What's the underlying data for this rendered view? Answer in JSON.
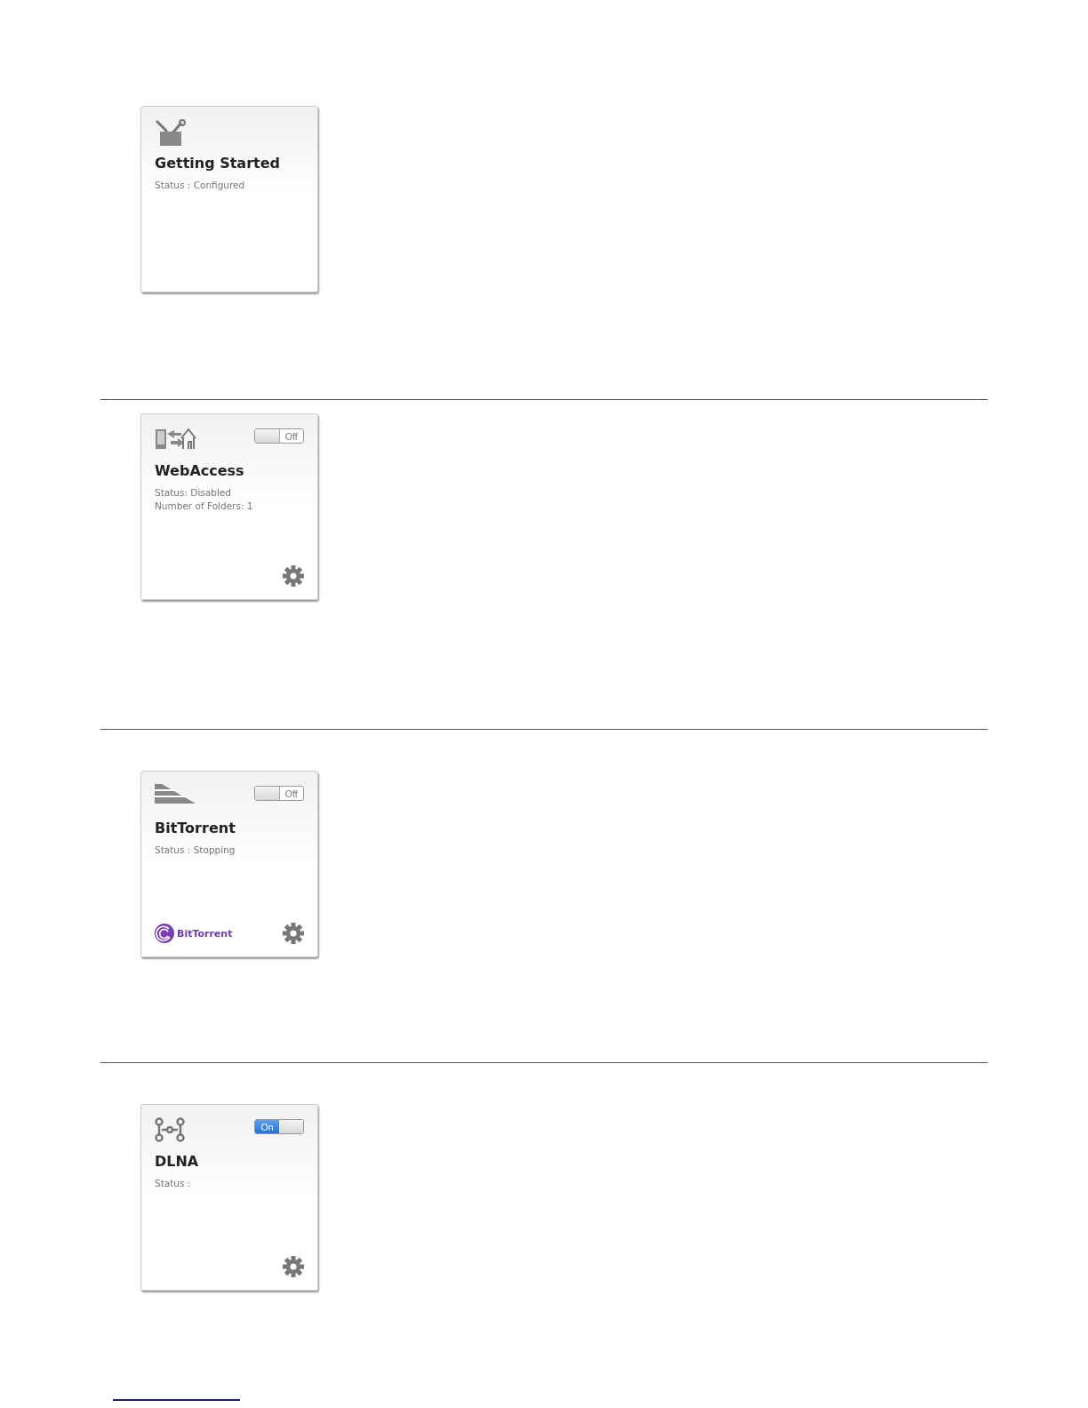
{
  "tiles": [
    {
      "kind": "toolbox",
      "title": "Getting Started",
      "status_lines": [
        "Status : Configured"
      ]
    },
    {
      "kind": "webaccess",
      "toggle": {
        "label": "Off",
        "on": false
      },
      "title": "WebAccess",
      "status_lines": [
        "Status: Disabled",
        "Number of Folders: 1"
      ],
      "settings": true
    },
    {
      "kind": "bittorrent",
      "toggle": {
        "label": "Off",
        "on": false
      },
      "title": "BitTorrent",
      "status_lines": [
        "Status : Stopping"
      ],
      "brand": "BitTorrent",
      "settings": true
    },
    {
      "kind": "dlna",
      "toggle": {
        "label": "On",
        "on": true
      },
      "title": "DLNA",
      "status_lines": [
        "Status :"
      ],
      "settings": true
    }
  ]
}
